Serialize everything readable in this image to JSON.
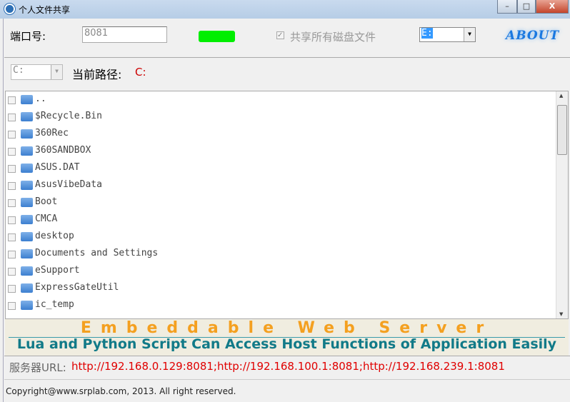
{
  "window": {
    "title": "个人文件共享",
    "minimize": "–",
    "maximize": "□",
    "close": "X"
  },
  "toolbar": {
    "port_label": "端口号:",
    "port_value": "8081",
    "share_all_label": "共享所有磁盘文件",
    "share_all_checked": true,
    "drive_value": "E:",
    "about_label": "ABOUT",
    "status_color": "#00ee00"
  },
  "path": {
    "drive_value": "C:",
    "label": "当前路径:",
    "current": "C:"
  },
  "files": [
    {
      "name": ".."
    },
    {
      "name": "$Recycle.Bin"
    },
    {
      "name": "360Rec"
    },
    {
      "name": "360SANDBOX"
    },
    {
      "name": "ASUS.DAT"
    },
    {
      "name": "AsusVibeData"
    },
    {
      "name": "Boot"
    },
    {
      "name": "CMCA"
    },
    {
      "name": "desktop"
    },
    {
      "name": "Documents and Settings"
    },
    {
      "name": "eSupport"
    },
    {
      "name": "ExpressGateUtil"
    },
    {
      "name": "ic_temp"
    }
  ],
  "banner": {
    "line1": "Embeddable Web Server",
    "line2": "Lua and Python Script Can Access Host Functions of Application Easily"
  },
  "server": {
    "label": "服务器URL:",
    "urls": "http://192.168.0.129:8081;http://192.168.100.1:8081;http://192.168.239.1:8081"
  },
  "footer": {
    "copyright": "Copyright@www.srplab.com, 2013.  All right reserved."
  }
}
